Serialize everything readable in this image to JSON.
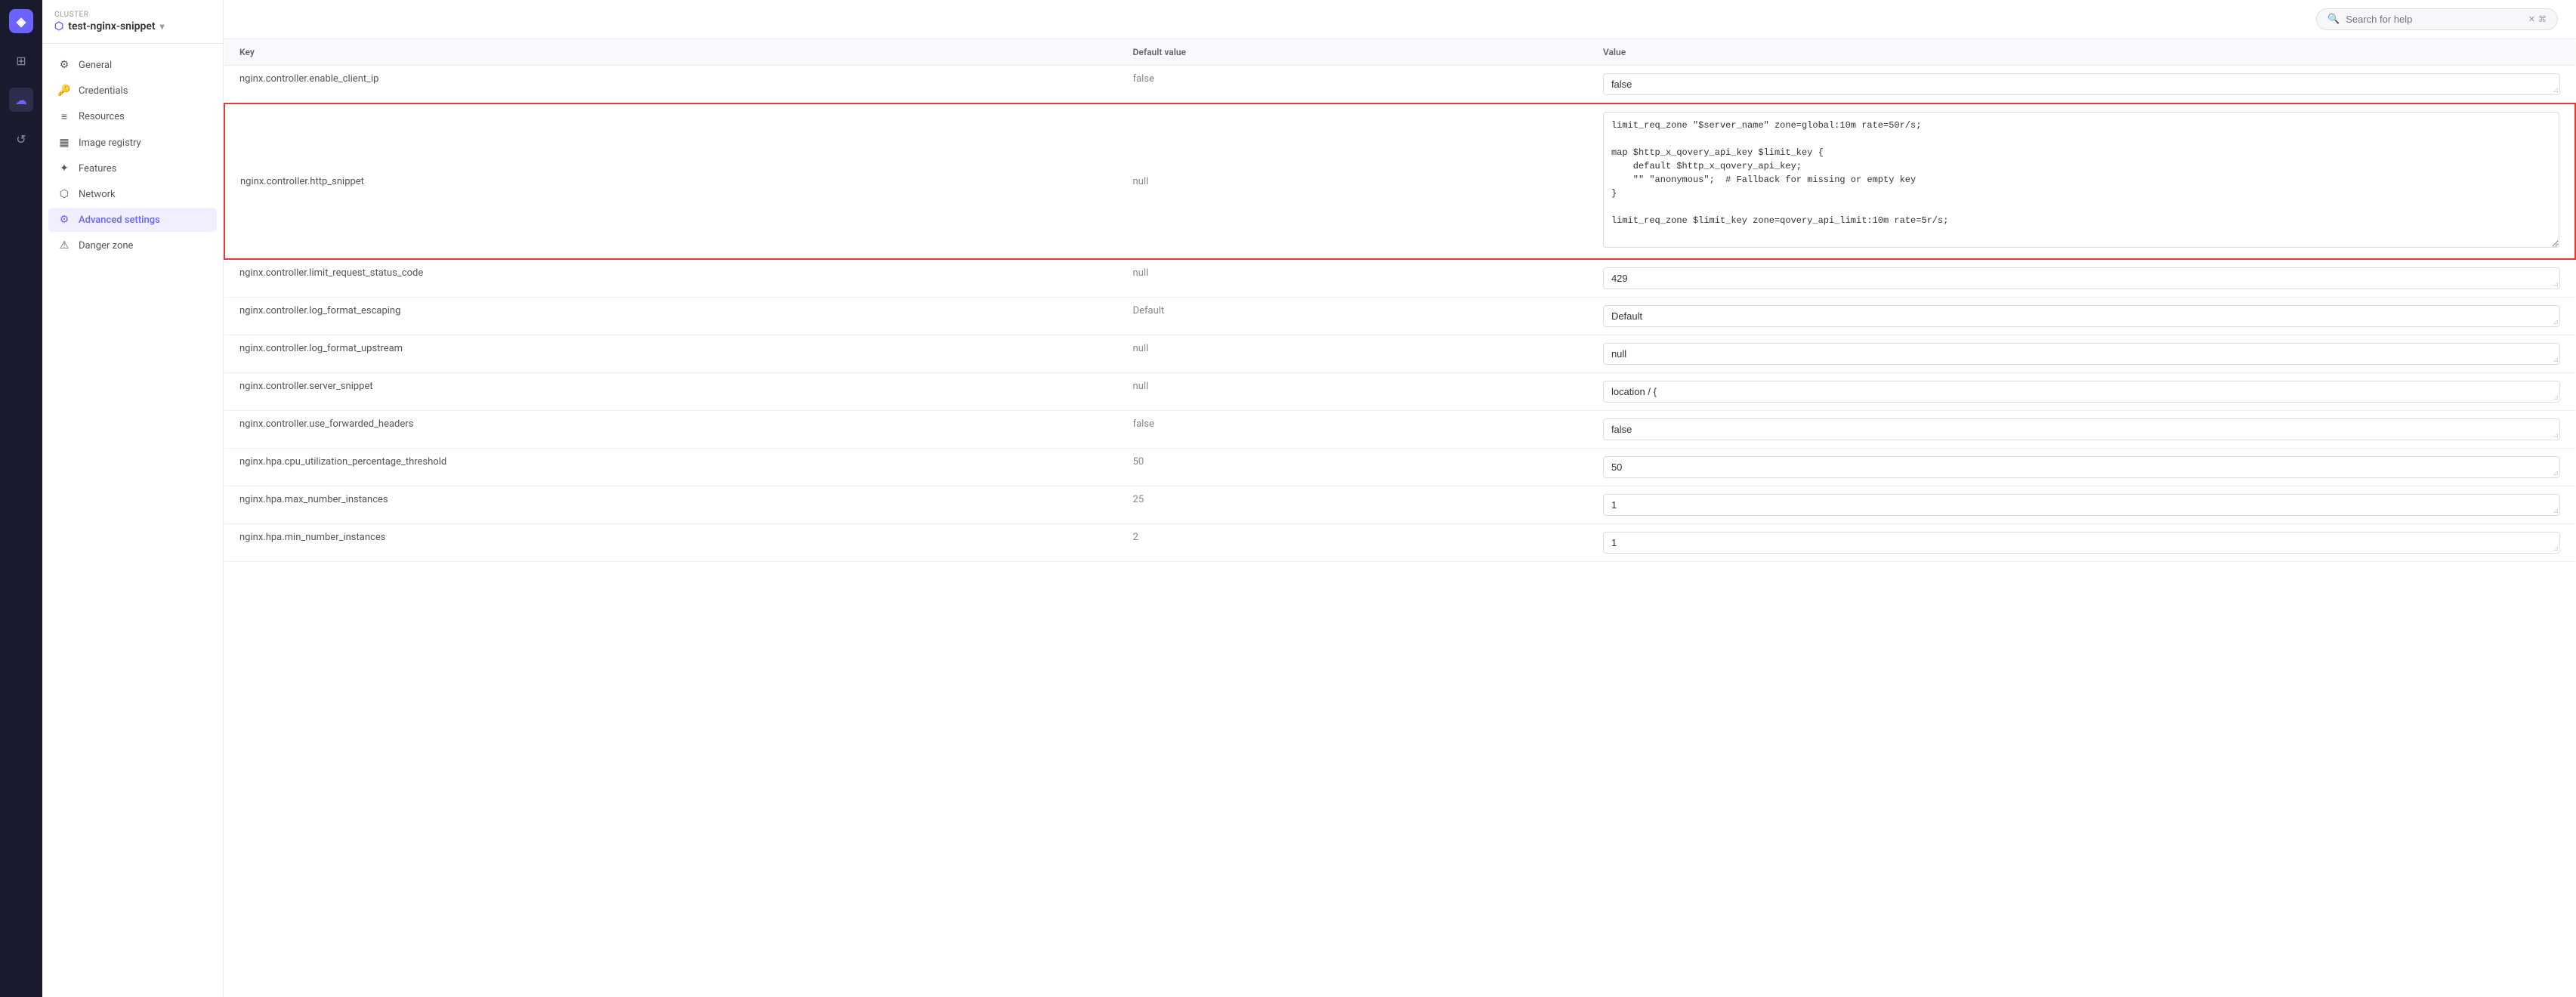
{
  "app": {
    "logo": "◈",
    "cluster_label": "Cluster",
    "cluster_name": "test-nginx-snippet",
    "search_placeholder": "Search for help"
  },
  "nav_icons": [
    {
      "name": "layers-icon",
      "symbol": "⊞",
      "active": false
    },
    {
      "name": "cloud-icon",
      "symbol": "☁",
      "active": true
    },
    {
      "name": "history-icon",
      "symbol": "↺",
      "active": false
    }
  ],
  "sidebar": {
    "items": [
      {
        "id": "general",
        "label": "General",
        "icon": "⚙",
        "active": false
      },
      {
        "id": "credentials",
        "label": "Credentials",
        "icon": "🔑",
        "active": false
      },
      {
        "id": "resources",
        "label": "Resources",
        "icon": "≡",
        "active": false
      },
      {
        "id": "image-registry",
        "label": "Image registry",
        "icon": "▦",
        "active": false
      },
      {
        "id": "features",
        "label": "Features",
        "icon": "✦",
        "active": false
      },
      {
        "id": "network",
        "label": "Network",
        "icon": "⬡",
        "active": false
      },
      {
        "id": "advanced-settings",
        "label": "Advanced settings",
        "icon": "⚙",
        "active": true
      },
      {
        "id": "danger-zone",
        "label": "Danger zone",
        "icon": "⚠",
        "active": false
      }
    ]
  },
  "table": {
    "columns": [
      "Key",
      "Default value",
      "Value"
    ],
    "rows": [
      {
        "id": "enable_client_ip",
        "key": "nginx.controller.enable_client_ip",
        "default": "false",
        "value": "false",
        "highlighted": false,
        "textarea": false
      },
      {
        "id": "http_snippet",
        "key": "nginx.controller.http_snippet",
        "default": "null",
        "value": "limit_req_zone \"$server_name\" zone=global:10m rate=50r/s;\n\nmap $http_x_qovery_api_key $limit_key {\n    default $http_x_qovery_api_key;\n    \"\" \"anonymous\";  # Fallback for missing or empty key\n}\n\nlimit_req_zone $limit_key zone=qovery_api_limit:10m rate=5r/s;",
        "highlighted": true,
        "textarea": true
      },
      {
        "id": "limit_request_status_code",
        "key": "nginx.controller.limit_request_status_code",
        "default": "null",
        "value": "429",
        "highlighted": false,
        "textarea": false
      },
      {
        "id": "log_format_escaping",
        "key": "nginx.controller.log_format_escaping",
        "default": "Default",
        "value": "Default",
        "highlighted": false,
        "textarea": false
      },
      {
        "id": "log_format_upstream",
        "key": "nginx.controller.log_format_upstream",
        "default": "null",
        "value": "null",
        "highlighted": false,
        "textarea": false
      },
      {
        "id": "server_snippet",
        "key": "nginx.controller.server_snippet",
        "default": "null",
        "value": "location / {",
        "highlighted": false,
        "textarea": false,
        "partial": true
      },
      {
        "id": "use_forwarded_headers",
        "key": "nginx.controller.use_forwarded_headers",
        "default": "false",
        "value": "false",
        "highlighted": false,
        "textarea": false
      },
      {
        "id": "cpu_utilization",
        "key": "nginx.hpa.cpu_utilization_percentage_threshold",
        "default": "50",
        "value": "50",
        "highlighted": false,
        "textarea": false
      },
      {
        "id": "max_number_instances",
        "key": "nginx.hpa.max_number_instances",
        "default": "25",
        "value": "1",
        "highlighted": false,
        "textarea": false
      },
      {
        "id": "min_number_instances",
        "key": "nginx.hpa.min_number_instances",
        "default": "2",
        "value": "1",
        "highlighted": false,
        "textarea": false
      }
    ]
  }
}
